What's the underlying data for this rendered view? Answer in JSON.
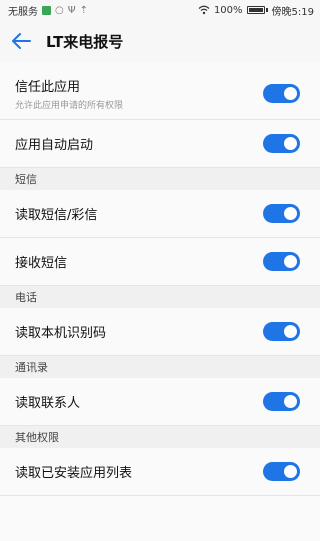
{
  "status_bar": {
    "carrier": "无服务",
    "battery": "100%",
    "time": "傍晚5:19"
  },
  "app_bar": {
    "title": "LT来电报号"
  },
  "rows_general": [
    {
      "title": "信任此应用",
      "subtitle": "允许此应用申请的所有权限",
      "enabled": true
    },
    {
      "title": "应用自动启动",
      "enabled": true
    }
  ],
  "sections": [
    {
      "header": "短信",
      "rows": [
        {
          "title": "读取短信/彩信",
          "enabled": true
        },
        {
          "title": "接收短信",
          "enabled": true
        }
      ]
    },
    {
      "header": "电话",
      "rows": [
        {
          "title": "读取本机识别码",
          "enabled": true
        }
      ]
    },
    {
      "header": "通讯录",
      "rows": [
        {
          "title": "读取联系人",
          "enabled": true
        }
      ]
    },
    {
      "header": "其他权限",
      "rows": [
        {
          "title": "读取已安装应用列表",
          "enabled": true
        }
      ]
    }
  ],
  "colors": {
    "accent": "#1f74e6"
  }
}
